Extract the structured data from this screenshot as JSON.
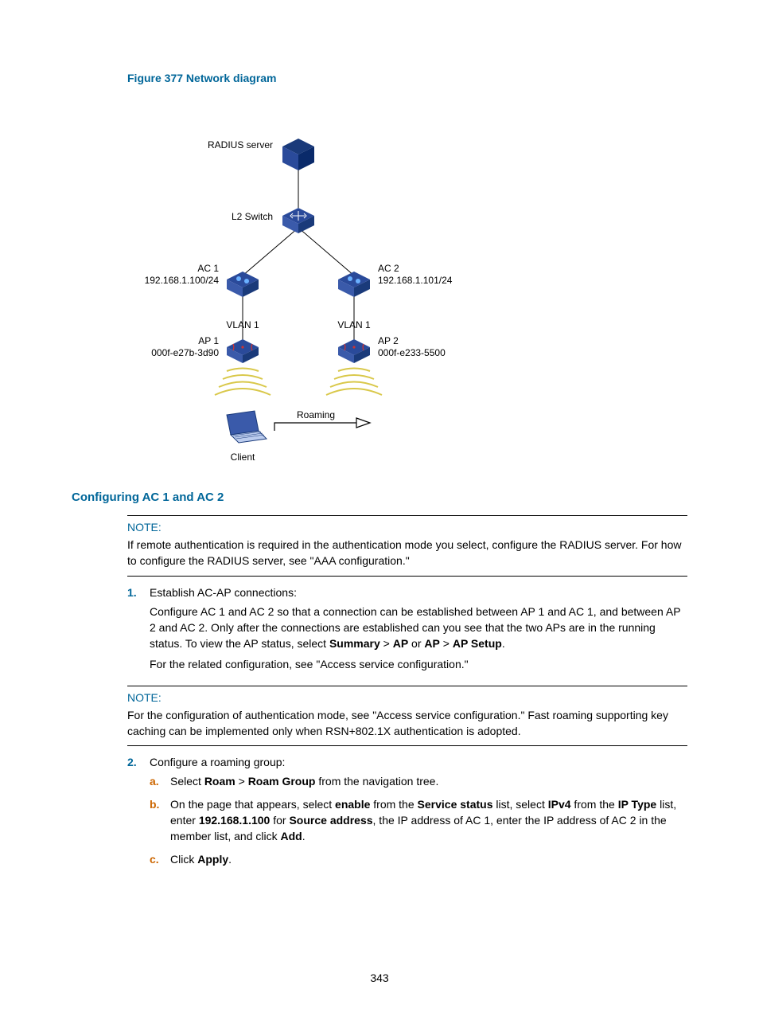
{
  "figure": {
    "title": "Figure 377 Network diagram",
    "labels": {
      "radius": "RADIUS server",
      "l2switch": "L2 Switch",
      "ac1_name": "AC 1",
      "ac1_ip": "192.168.1.100/24",
      "ac2_name": "AC 2",
      "ac2_ip": "192.168.1.101/24",
      "vlan1_left": "VLAN 1",
      "vlan1_right": "VLAN 1",
      "ap1_name": "AP 1",
      "ap1_mac": "000f-e27b-3d90",
      "ap2_name": "AP 2",
      "ap2_mac": "000f-e233-5500",
      "roaming": "Roaming",
      "client": "Client"
    }
  },
  "section_heading": "Configuring AC 1 and AC 2",
  "note1": {
    "label": "NOTE:",
    "text": "If remote authentication is required in the authentication mode you select, configure the RADIUS server. For how to configure the RADIUS server, see \"AAA configuration.\""
  },
  "step1": {
    "marker": "1.",
    "title": "Establish AC-AP connections:",
    "p1_pre": "Configure AC 1 and AC 2 so that a connection can be established between AP 1 and AC 1, and between AP 2 and AC 2. Only after the connections are established can you see that the two APs are in the running status. To view the AP status, select ",
    "summary": "Summary",
    "gt1": " > ",
    "ap": "AP",
    "or": " or ",
    "ap2": "AP",
    "gt2": " > ",
    "apsetup": "AP Setup",
    "p1_post": ".",
    "p2": "For the related configuration, see \"Access service configuration.\""
  },
  "note2": {
    "label": "NOTE:",
    "text": "For the configuration of authentication mode, see \"Access service configuration.\" Fast roaming supporting key caching can be implemented only when RSN+802.1X authentication is adopted."
  },
  "step2": {
    "marker": "2.",
    "title": "Configure a roaming group:",
    "a": {
      "marker": "a.",
      "pre": "Select ",
      "roam": "Roam",
      "gt": " > ",
      "roamgroup": "Roam Group",
      "post": " from the navigation tree."
    },
    "b": {
      "marker": "b.",
      "pre": "On the page that appears, select ",
      "enable": "enable",
      "t2": " from the ",
      "ss": "Service status",
      "t3": " list, select ",
      "ipv4": "IPv4",
      "t4": " from the ",
      "iptype": "IP Type",
      "t5": " list, enter ",
      "ip": "192.168.1.100",
      "t6": " for ",
      "src": "Source address",
      "t7": ", the IP address of AC 1, enter the IP address of AC 2 in the member list, and click ",
      "add": "Add",
      "post": "."
    },
    "c": {
      "marker": "c.",
      "pre": "Click ",
      "apply": "Apply",
      "post": "."
    }
  },
  "page_number": "343"
}
